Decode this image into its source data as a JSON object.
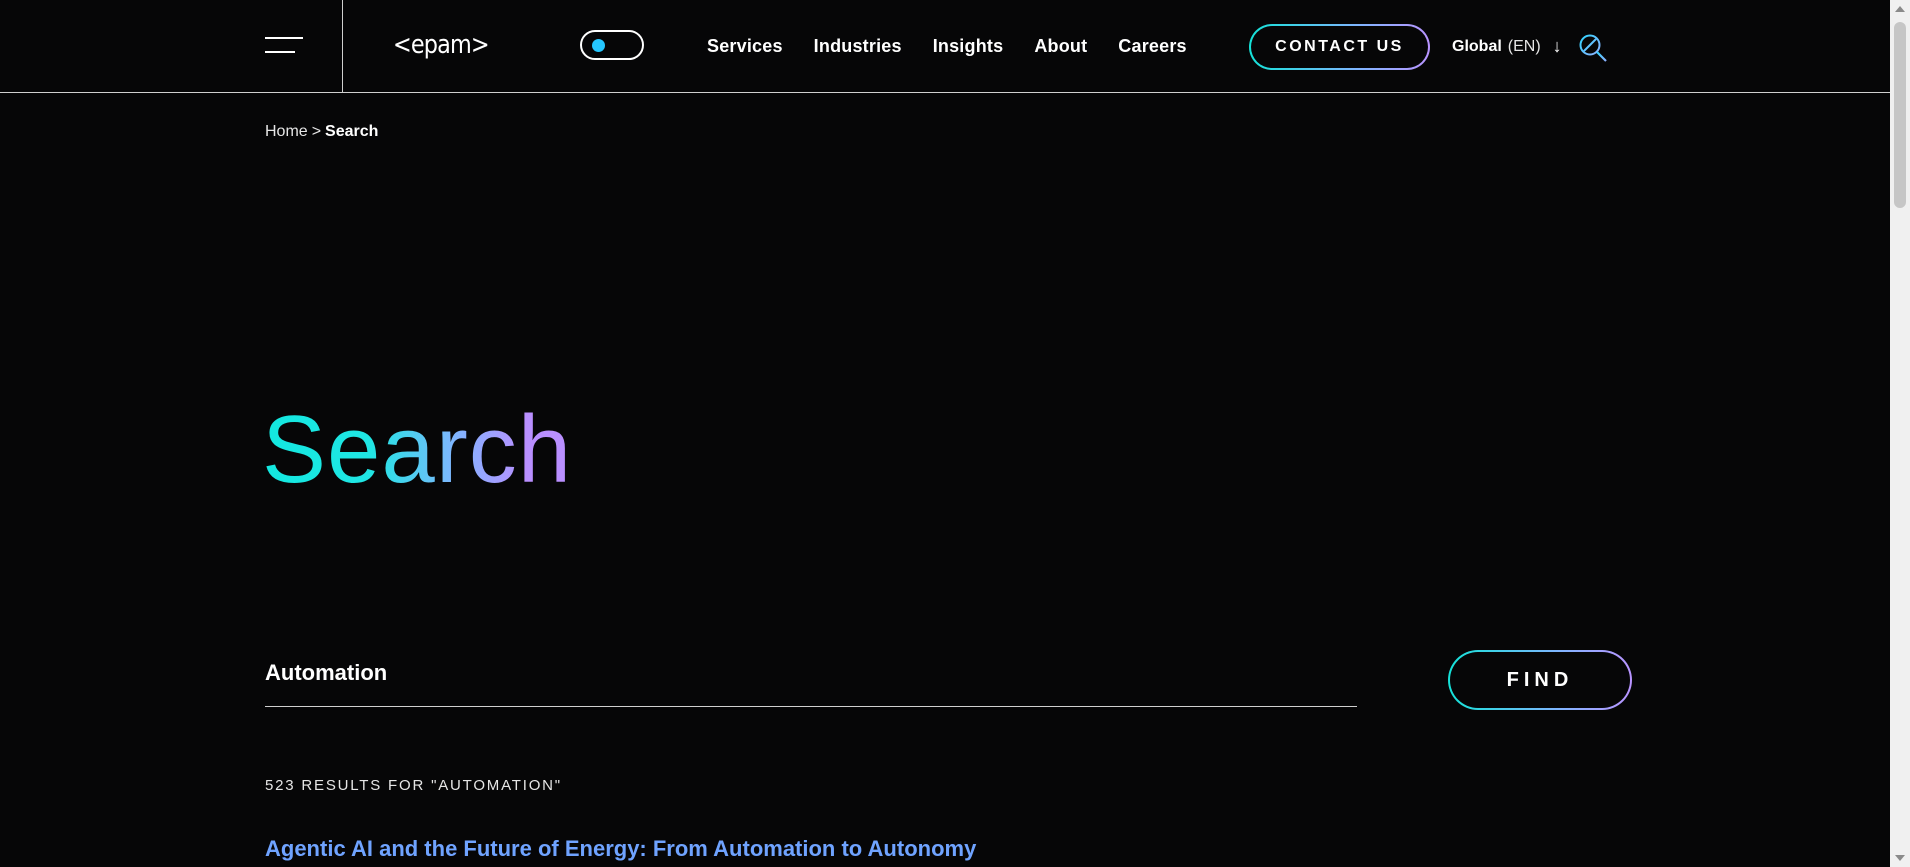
{
  "header": {
    "logo_text": "<epam>",
    "nav": [
      {
        "label": "Services"
      },
      {
        "label": "Industries"
      },
      {
        "label": "Insights"
      },
      {
        "label": "About"
      },
      {
        "label": "Careers"
      }
    ],
    "contact_label": "CONTACT US",
    "locale": {
      "region": "Global",
      "lang": "(EN)",
      "arrow": "↓"
    },
    "icons": {
      "menu": "hamburger-menu-icon",
      "theme": "theme-toggle",
      "search": "search-icon"
    }
  },
  "breadcrumb": {
    "home": "Home",
    "separator": ">",
    "current": "Search"
  },
  "page_title": "Search",
  "search": {
    "value": "Automation",
    "button_label": "FIND"
  },
  "results": {
    "count_text": "523 RESULTS FOR \"AUTOMATION\"",
    "items": [
      {
        "title": "Agentic AI and the Future of Energy: From Automation to Autonomy"
      }
    ]
  },
  "colors": {
    "background": "#060607",
    "accent_cyan": "#12e8e0",
    "accent_purple": "#b98fff",
    "link": "#6fa3ff",
    "toggle_knob": "#25c7ff"
  }
}
